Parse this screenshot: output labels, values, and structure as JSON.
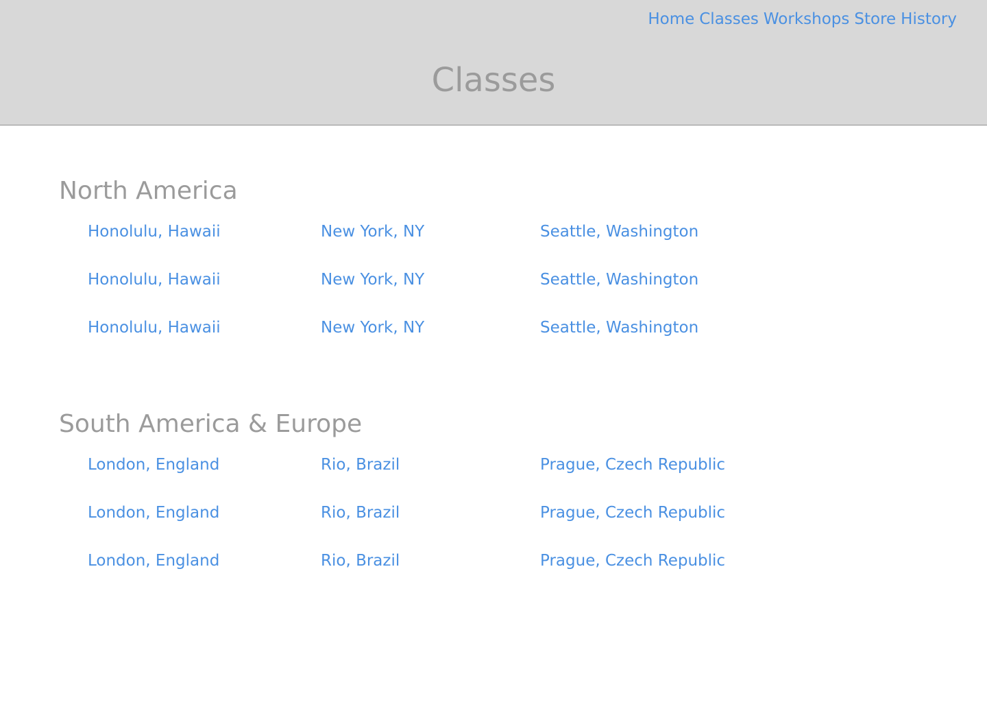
{
  "nav": {
    "items": [
      "Home",
      "Classes",
      "Workshops",
      "Store",
      "History"
    ]
  },
  "page": {
    "title": "Classes"
  },
  "regions": [
    {
      "title": "North America",
      "rows": [
        [
          "Honolulu, Hawaii",
          "New York, NY",
          "Seattle, Washington"
        ],
        [
          "Honolulu, Hawaii",
          "New York, NY",
          "Seattle, Washington"
        ],
        [
          "Honolulu, Hawaii",
          "New York, NY",
          "Seattle, Washington"
        ]
      ]
    },
    {
      "title": "South America & Europe",
      "rows": [
        [
          "London, England",
          "Rio, Brazil",
          "Prague, Czech Republic"
        ],
        [
          "London, England",
          "Rio, Brazil",
          "Prague, Czech Republic"
        ],
        [
          "London, England",
          "Rio, Brazil",
          "Prague, Czech Republic"
        ]
      ]
    }
  ],
  "colors": {
    "header_background": "#d8d8d8",
    "heading_gray": "#9b9b9b",
    "link_blue": "#4a90e2",
    "page_background": "#ffffff"
  }
}
